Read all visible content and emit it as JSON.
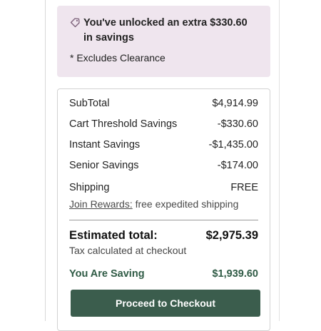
{
  "promo": {
    "title": "You've unlocked an extra $330.60 in savings",
    "note": "* Excludes Clearance",
    "icon": "price-tag-icon",
    "background": "#efe5ee"
  },
  "summary": {
    "lines": [
      {
        "label": "SubTotal",
        "value": "$4,914.99"
      },
      {
        "label": "Cart Threshold Savings",
        "value": "-$330.60"
      },
      {
        "label": "Instant Savings",
        "value": "-$1,435.00"
      },
      {
        "label": "Senior Savings",
        "value": "-$174.00"
      },
      {
        "label": "Shipping",
        "value": "FREE"
      }
    ],
    "rewards_link": "Join Rewards:",
    "rewards_text": "free expedited shipping",
    "total_label": "Estimated total:",
    "total_value": "$2,975.39",
    "tax_note": "Tax calculated at checkout",
    "saving_label": "You Are Saving",
    "saving_value": "$1,939.60",
    "checkout_label": "Proceed to Checkout",
    "accent_color": "#3b5d4d"
  }
}
